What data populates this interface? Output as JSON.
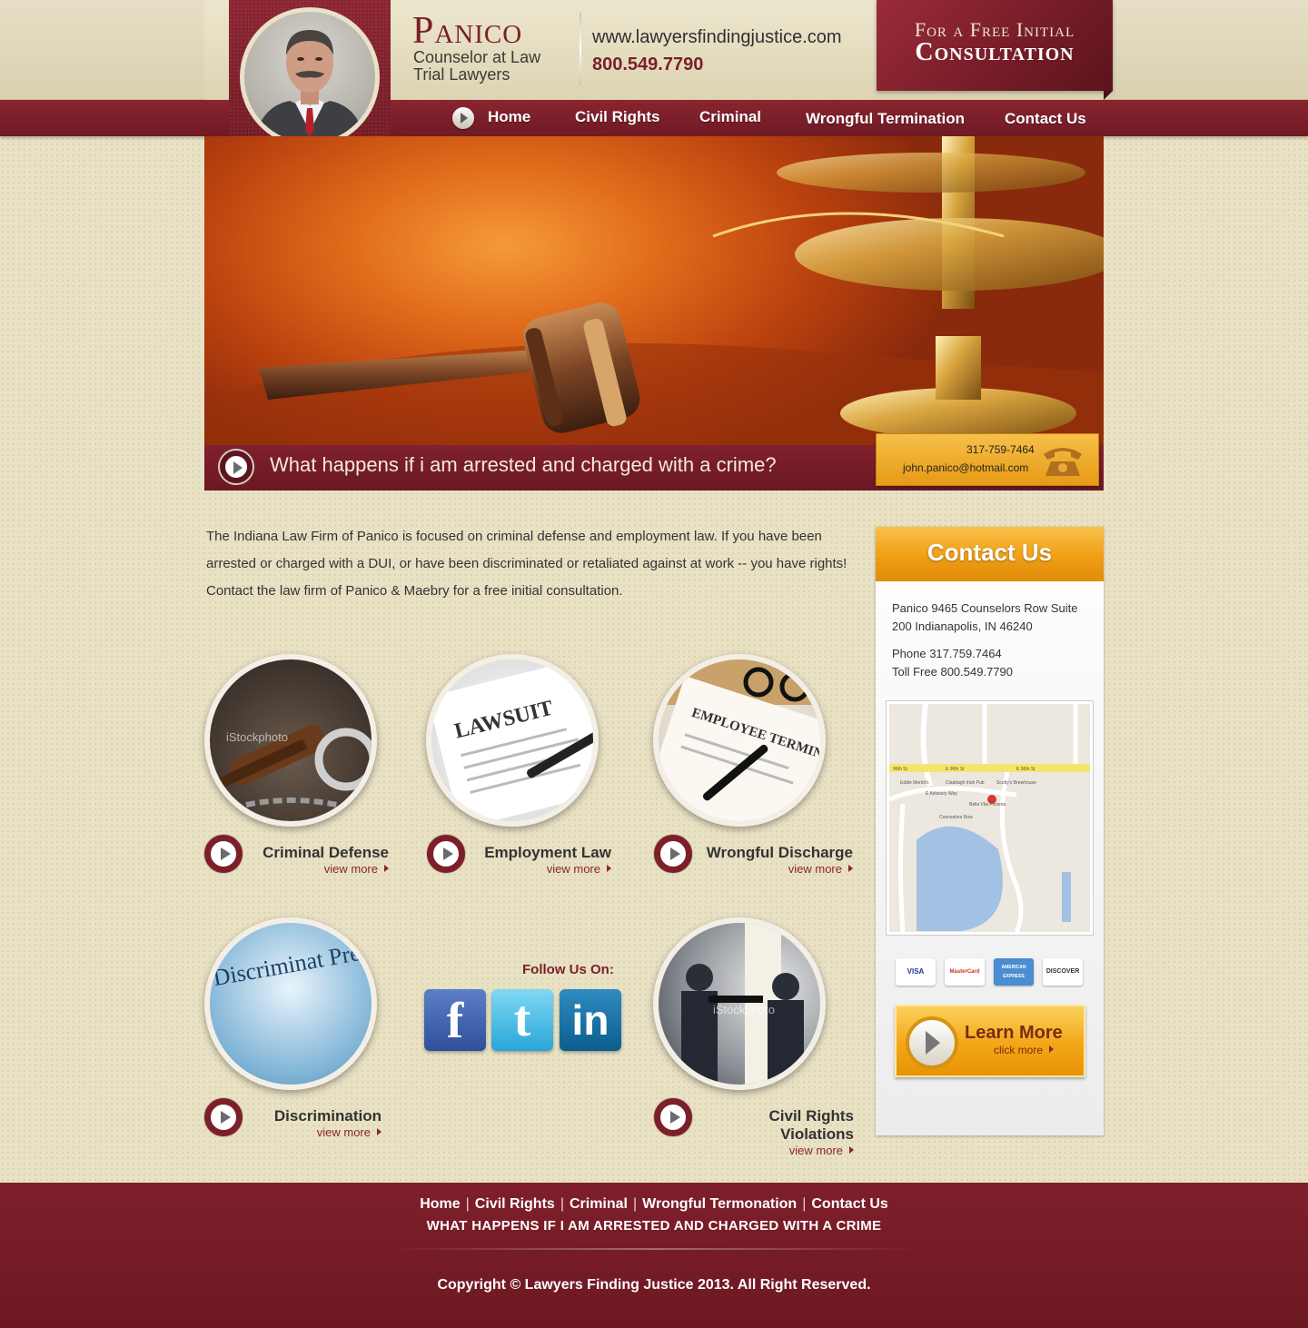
{
  "header": {
    "brand": "Panico",
    "subtitle_line1": "Counselor at Law",
    "subtitle_line2": "Trial Lawyers",
    "website": "www.lawyersfindingjustice.com",
    "phone": "800.549.7790",
    "consult_line1": "For a Free Initial",
    "consult_line2": "Consultation"
  },
  "nav": {
    "items": [
      "Home",
      "Civil Rights",
      "Criminal",
      "Wrongful Termination",
      "Contact Us"
    ]
  },
  "hero": {
    "question": "What happens if i am arrested and charged with a crime?",
    "contact_phone": "317-759-7464",
    "contact_email": "john.panico@hotmail.com"
  },
  "intro": {
    "text": "The Indiana Law Firm of Panico is focused on criminal defense and employment law.  If you have been arrested or charged with a DUI, or have been discriminated or retaliated against at work -- you have rights! Contact the law firm of Panico & Maebry for a free initial consultation."
  },
  "services": [
    {
      "title": "Criminal Defense",
      "more": "view more",
      "image_text": "iStockphoto"
    },
    {
      "title": "Employment Law",
      "more": "view more",
      "image_text": "LAWSUIT"
    },
    {
      "title": "Wrongful Discharge",
      "more": "view more",
      "image_text": "EMPLOYEE TERMINATION"
    },
    {
      "title": "Discrimination",
      "more": "view more",
      "image_text": "Discriminat Prejudice resultin unfair treatment promotion, or tr racticed comp"
    },
    {
      "title": "Civil Rights Violations",
      "more": "view more",
      "image_text": "iStockphoto"
    }
  ],
  "social": {
    "label": "Follow Us On:",
    "icons": [
      "facebook-icon",
      "twitter-icon",
      "linkedin-icon"
    ]
  },
  "sidebar": {
    "title": "Contact Us",
    "address_line1": "Panico 9465 Counselors Row Suite",
    "address_line2": "200 Indianapolis, IN 46240",
    "phone": "Phone 317.759.7464",
    "tollfree": "Toll Free 800.549.7790",
    "map_labels": {
      "street_96th_left": "96th St",
      "street_96th_mid": "E 96th St",
      "street_96th_right": "E 96th St",
      "advisory": "E Advisory Way",
      "counselors_row": "Counselors Row",
      "eddie": "Eddie Merlot's",
      "claddagh": "Claddagh Irish Pub",
      "scotty": "Scotty's Brewhouse",
      "bella": "Bella Vita Pizzeria"
    },
    "cards": [
      "VISA",
      "MasterCard",
      "AMERICAN EXPRESS",
      "DISCOVER"
    ],
    "learn_more": "Learn More",
    "click_more": "click more"
  },
  "footer": {
    "links": [
      "Home",
      "Civil Rights",
      "Criminal",
      "Wrongful Termonation",
      "Contact Us"
    ],
    "question": "WHAT HAPPENS IF I AM ARRESTED AND CHARGED WITH A CRIME",
    "copyright": "Copyright © Lawyers Finding Justice 2013. All Right Reserved."
  },
  "colors": {
    "maroon": "#7a1f2a",
    "gold": "#ef9e15",
    "cream": "#e8e1c4"
  }
}
